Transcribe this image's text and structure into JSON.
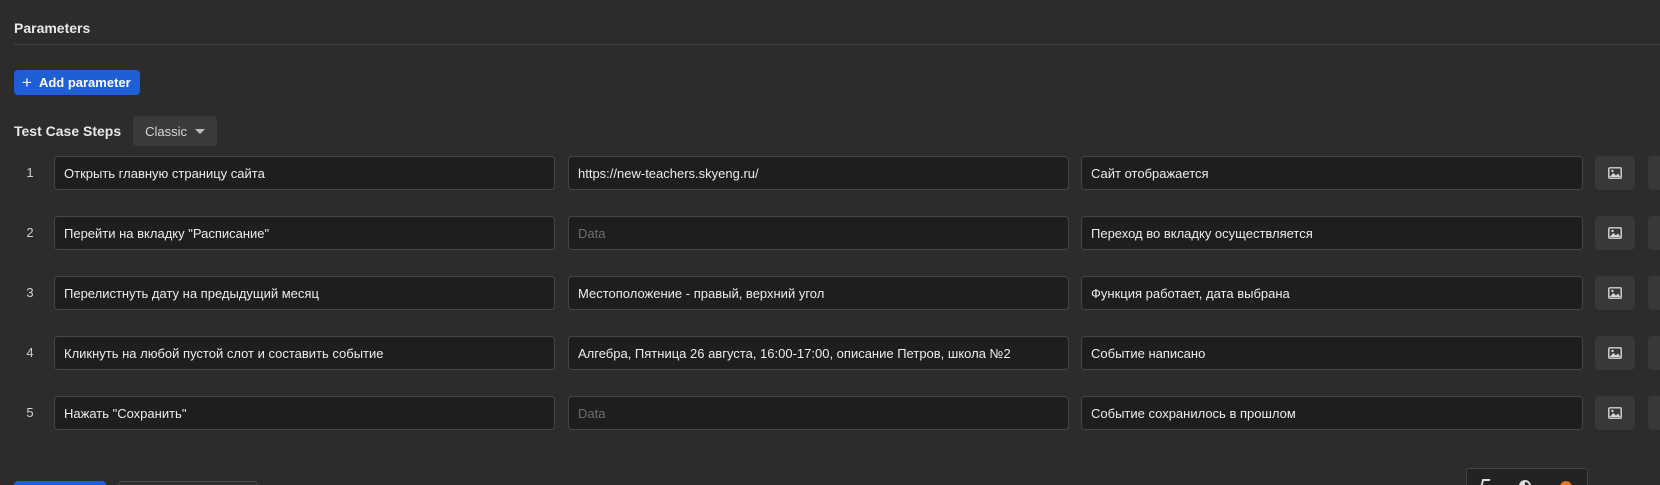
{
  "parameters": {
    "title": "Parameters",
    "add_button_label": "Add parameter"
  },
  "test_case_steps": {
    "title": "Test Case Steps",
    "mode": "Classic",
    "data_placeholder": "Data",
    "steps": [
      {
        "number": "1",
        "action": "Открыть главную страницу сайта",
        "data": "https://new-teachers.skyeng.ru/",
        "expected_result": "Сайт отображается"
      },
      {
        "number": "2",
        "action": "Перейти на вкладку \"Расписание\"",
        "data": "",
        "expected_result": "Переход во вкладку осуществляется"
      },
      {
        "number": "3",
        "action": "Перелистнуть дату на предыдущий месяц",
        "data": "Местоположение - правый, верхний угол",
        "expected_result": "Функция работает, дата выбрана"
      },
      {
        "number": "4",
        "action": "Кликнуть на любой пустой слот и составить событие",
        "data": "Алгебра, Пятница 26 августа, 16:00-17:00, описание Петров, школа №2",
        "expected_result": "Событие написано"
      },
      {
        "number": "5",
        "action": "Нажать \"Сохранить\"",
        "data": "",
        "expected_result": "Событие сохранилось в прошлом"
      }
    ]
  },
  "icons": {
    "add": "plus-icon",
    "mode_dropdown": "caret-down-icon",
    "attach": "image-icon"
  },
  "colors": {
    "background": "#2c2c2c",
    "primary": "#1f5fd6",
    "input_background": "#1f1e1f",
    "accent_orange": "#e8751a"
  }
}
